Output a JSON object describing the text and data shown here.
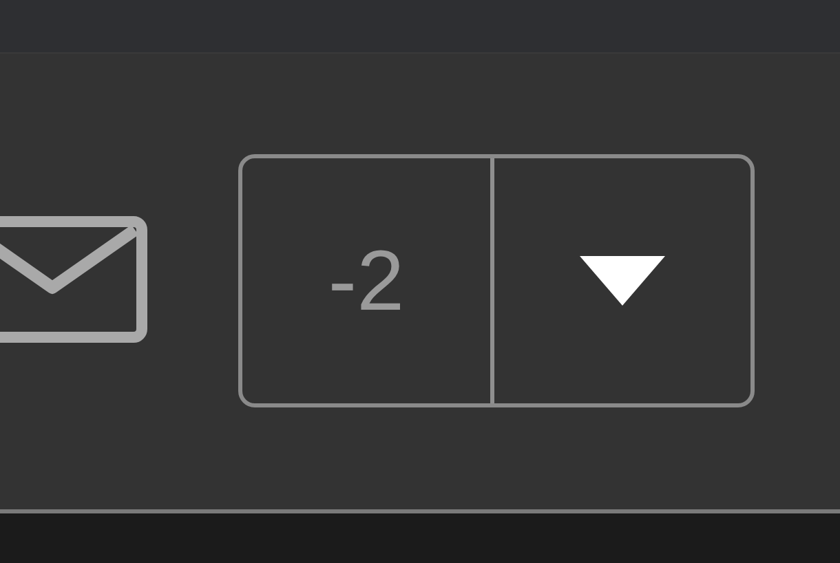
{
  "vote_selector": {
    "value": "-2"
  }
}
